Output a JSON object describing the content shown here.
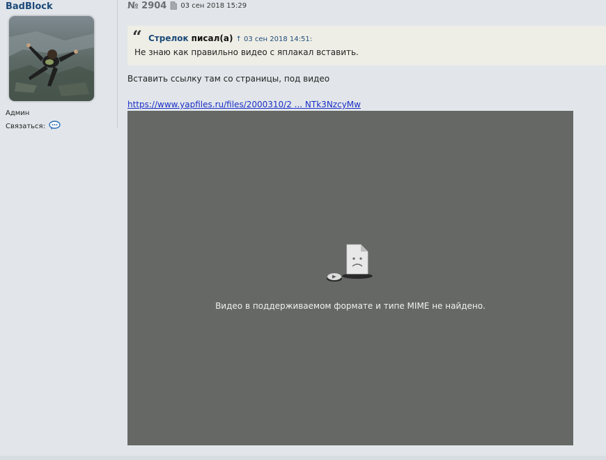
{
  "author": {
    "name": "BadBlock",
    "role": "Админ",
    "contact_label": "Связаться:",
    "avatar_icon": "skydiver-avatar",
    "contact_icon": "chat-bubble-icon"
  },
  "post": {
    "number": "№ 2904",
    "date": "03 сен 2018 15:29",
    "quote": {
      "author": "Стрелок",
      "wrote": "писал(а)",
      "date": "↑ 03 сен 2018 14:51:",
      "text": "Не знаю как правильно видео с яплакал вставить."
    },
    "body": "Вставить ссылку там со страницы, под видео",
    "link": "https://www.yapfiles.ru/files/2000310/2 ... NTk3NzcyMw",
    "video": {
      "message": "Видео в поддерживаемом формате и типе MIME не найдено.",
      "background": "#666866"
    }
  },
  "colors": {
    "page_bg": "#e2e6ea",
    "link": "#1a2fc7",
    "username": "#1c4a79",
    "quote_bg": "#eeeee6"
  }
}
